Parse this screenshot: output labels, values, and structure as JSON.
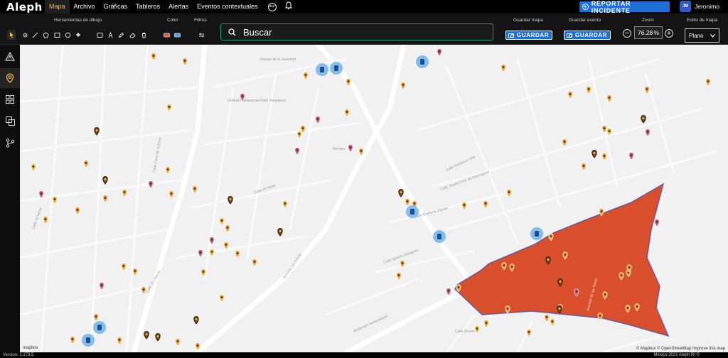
{
  "app": {
    "logo": "Aleph"
  },
  "nav": {
    "items": [
      "Mapa",
      "Archivo",
      "Gráficas",
      "Tableros",
      "Alertas",
      "Eventos contextuales"
    ],
    "more_icon": "ellipsis-icon",
    "bell_icon": "bell-icon",
    "report_label": "REPORTAR INCIDENTE",
    "user_initials": "JM",
    "user_name": "Jeronimo"
  },
  "toolbar": {
    "drawing_tools_label": "Herramientas de dibujo",
    "color_label": "Color",
    "filters_label": "Filtros",
    "search_placeholder": "Buscar",
    "save_map_label": "Guardar mapa",
    "save_event_label": "Guardar evento",
    "save_button": "GUARDAR",
    "zoom_label": "Zoom",
    "zoom_value": "76.28",
    "zoom_unit": "%",
    "map_style_label": "Estilo de mapa",
    "map_style_value": "Plano"
  },
  "sidebar": {
    "icons": [
      "alert-triangle-icon",
      "map-pin-icon",
      "grid-icon",
      "layers-icon",
      "branch-icon"
    ]
  },
  "map": {
    "accent_color": "#d94f2c",
    "marker_colors": {
      "orange": "#f0a23a",
      "yellow": "#e8b93f",
      "pink": "#c85a7a",
      "dark": "#7a4a1a",
      "station": "#6fb4ea"
    },
    "street_labels": [
      "Avenida 18 Oriente",
      "Boulevard Xonacatepec",
      "Calle Francisco Villa",
      "Calle Josefa Ortiz de Domínguez",
      "Calle Ignacio Zaragoza",
      "Calle Emiliano Zapata",
      "Avenida de las Torres",
      "Calle 20 Oriente",
      "Calle Carril de la Rosa",
      "Calle 34 Norte",
      "Calle Pinzón",
      "Calle 42 Norte",
      "Parque de la Juventud",
      "Unidad Habitacional Fidel Velazquez",
      "Seriana"
    ],
    "attribution_mapbox": "mapbox",
    "attribution_right": "© Mapbox © OpenStreetMap Improve this map"
  },
  "footer": {
    "version": "Version: 1.173.5",
    "copyright": "México 2021 Aleph RI ©"
  }
}
